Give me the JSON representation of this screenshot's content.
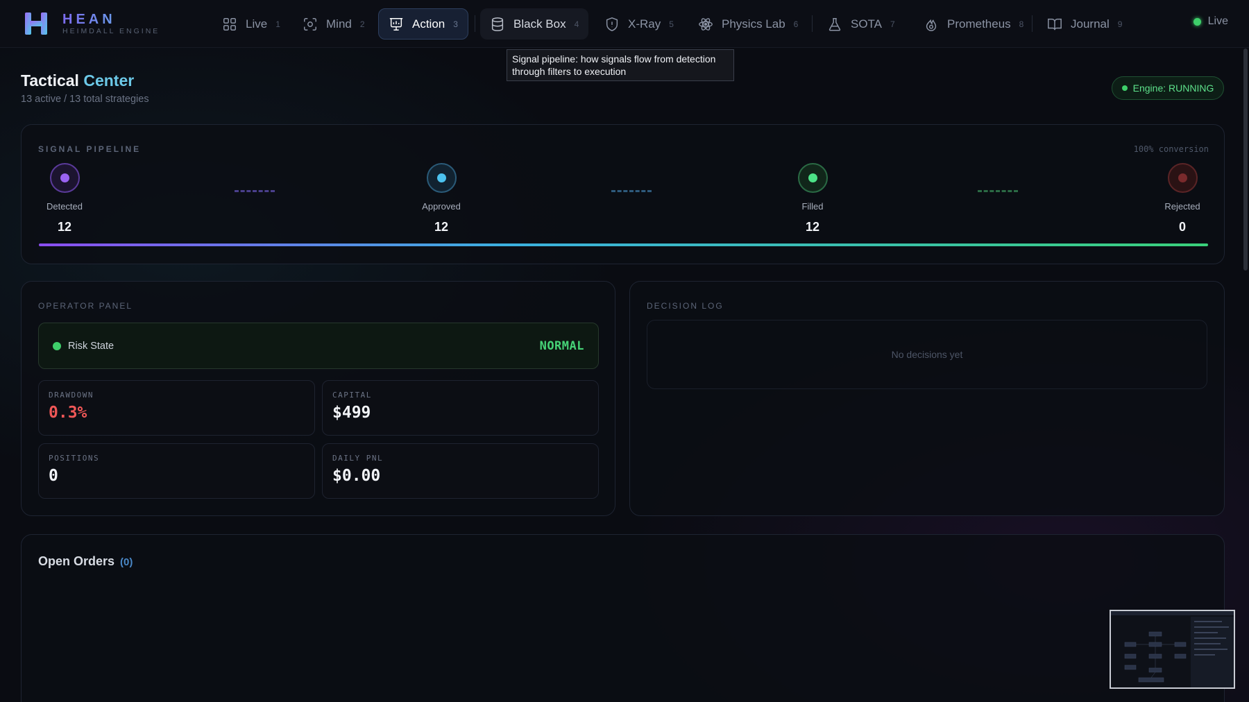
{
  "brand": {
    "name": "HEAN",
    "subtitle": "HEIMDALL ENGINE"
  },
  "nav": [
    {
      "label": "Live",
      "num": "1",
      "icon": "grid-icon"
    },
    {
      "label": "Mind",
      "num": "2",
      "icon": "focus-icon"
    },
    {
      "label": "Action",
      "num": "3",
      "icon": "presentation-icon",
      "active": true
    },
    {
      "label": "Black Box",
      "num": "4",
      "icon": "database-icon"
    },
    {
      "label": "X-Ray",
      "num": "5",
      "icon": "shield-icon"
    },
    {
      "label": "Physics Lab",
      "num": "6",
      "icon": "atom-icon"
    },
    {
      "label": "SOTA",
      "num": "7",
      "icon": "flask-icon"
    },
    {
      "label": "Prometheus",
      "num": "8",
      "icon": "flame-icon"
    },
    {
      "label": "Journal",
      "num": "9",
      "icon": "book-icon"
    }
  ],
  "live_status": "Live",
  "tooltip": "Signal pipeline: how signals flow from detection through filters to execution",
  "header": {
    "title_main": "Tactical",
    "title_accent": "Center",
    "subtitle": "13 active / 13 total strategies",
    "engine_status": "Engine: RUNNING"
  },
  "pipeline": {
    "label": "SIGNAL PIPELINE",
    "conversion": "100% conversion",
    "stages": [
      {
        "name": "Detected",
        "count": "12",
        "color": "#8b4df0"
      },
      {
        "name": "Approved",
        "count": "12",
        "color": "#3bb0e0"
      },
      {
        "name": "Filled",
        "count": "12",
        "color": "#3ad07a"
      },
      {
        "name": "Rejected",
        "count": "0",
        "color": "#e04848"
      }
    ]
  },
  "operator": {
    "label": "OPERATOR PANEL",
    "risk_label": "Risk State",
    "risk_value": "NORMAL",
    "drawdown_label": "DRAWDOWN",
    "drawdown_value": "0.3%",
    "capital_label": "CAPITAL",
    "capital_value": "$499",
    "positions_label": "POSITIONS",
    "positions_value": "0",
    "pnl_label": "DAILY PNL",
    "pnl_value": "$0.00"
  },
  "decision_log": {
    "label": "DECISION LOG",
    "empty": "No decisions yet"
  },
  "orders": {
    "title": "Open Orders",
    "count": "(0)"
  }
}
